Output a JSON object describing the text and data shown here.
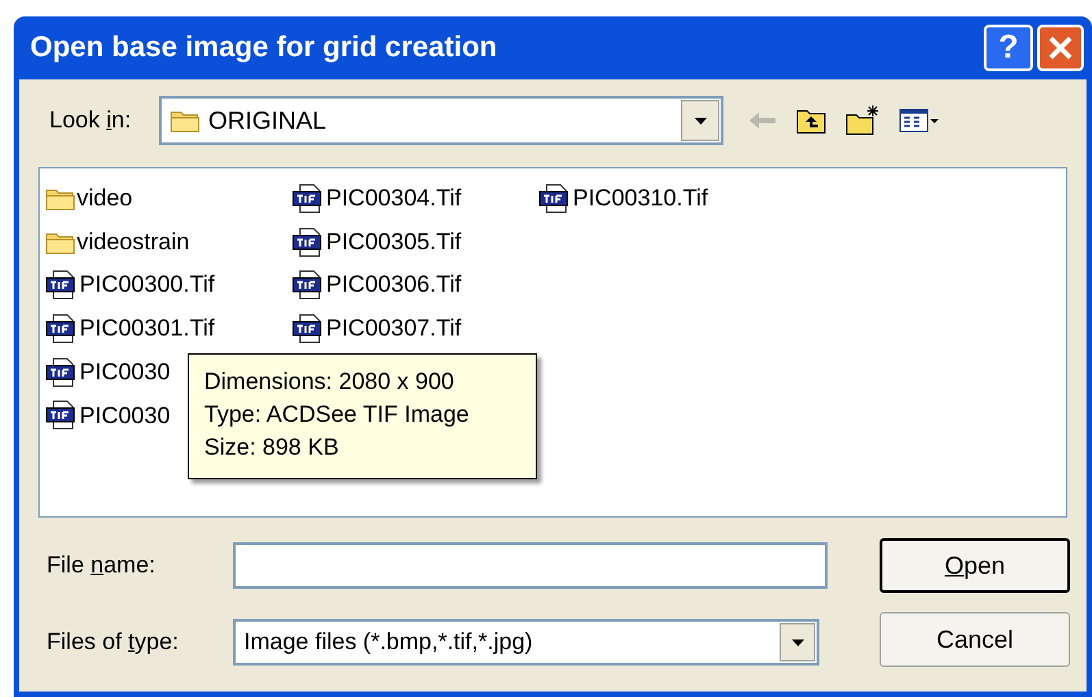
{
  "window": {
    "title": "Open base image for grid creation",
    "help_button": "?"
  },
  "look_in": {
    "label": {
      "before": "Look ",
      "key": "i",
      "after": "n:"
    },
    "value": "ORIGINAL"
  },
  "toolbar": [
    {
      "kind": "back",
      "disabled": true
    },
    {
      "kind": "up",
      "disabled": false
    },
    {
      "kind": "new_folder",
      "disabled": false
    },
    {
      "kind": "view",
      "disabled": false
    }
  ],
  "file_list": {
    "columns": [
      {
        "items": [
          {
            "kind": "folder",
            "name": "video"
          },
          {
            "kind": "folder",
            "name": "videostrain"
          },
          {
            "kind": "tif",
            "name": "PIC00300.Tif"
          },
          {
            "kind": "tif",
            "name": "PIC00301.Tif"
          },
          {
            "kind": "tif",
            "name": "PIC0030"
          },
          {
            "kind": "tif",
            "name": "PIC0030"
          }
        ]
      },
      {
        "items": [
          {
            "kind": "tif",
            "name": "PIC00304.Tif"
          },
          {
            "kind": "tif",
            "name": "PIC00305.Tif"
          },
          {
            "kind": "tif",
            "name": "PIC00306.Tif"
          },
          {
            "kind": "tif",
            "name": "PIC00307.Tif"
          }
        ]
      },
      {
        "items": [
          {
            "kind": "tif",
            "name": "PIC00310.Tif"
          }
        ]
      }
    ]
  },
  "tooltip": [
    "Dimensions: 2080 x 900",
    "Type: ACDSee TIF Image",
    "Size: 898 KB"
  ],
  "file_name": {
    "label": {
      "before": "File ",
      "key": "n",
      "after": "ame:"
    }
  },
  "files_of_type": {
    "label": {
      "before": "Files of ",
      "key": "t",
      "after": "ype:"
    },
    "value": "Image files (*.bmp,*.tif,*.jpg)"
  },
  "buttons": [
    {
      "kind": "default",
      "label": {
        "key": "O",
        "after": "pen"
      }
    },
    {
      "kind": "normal",
      "label": {
        "before": "Cancel"
      }
    }
  ]
}
